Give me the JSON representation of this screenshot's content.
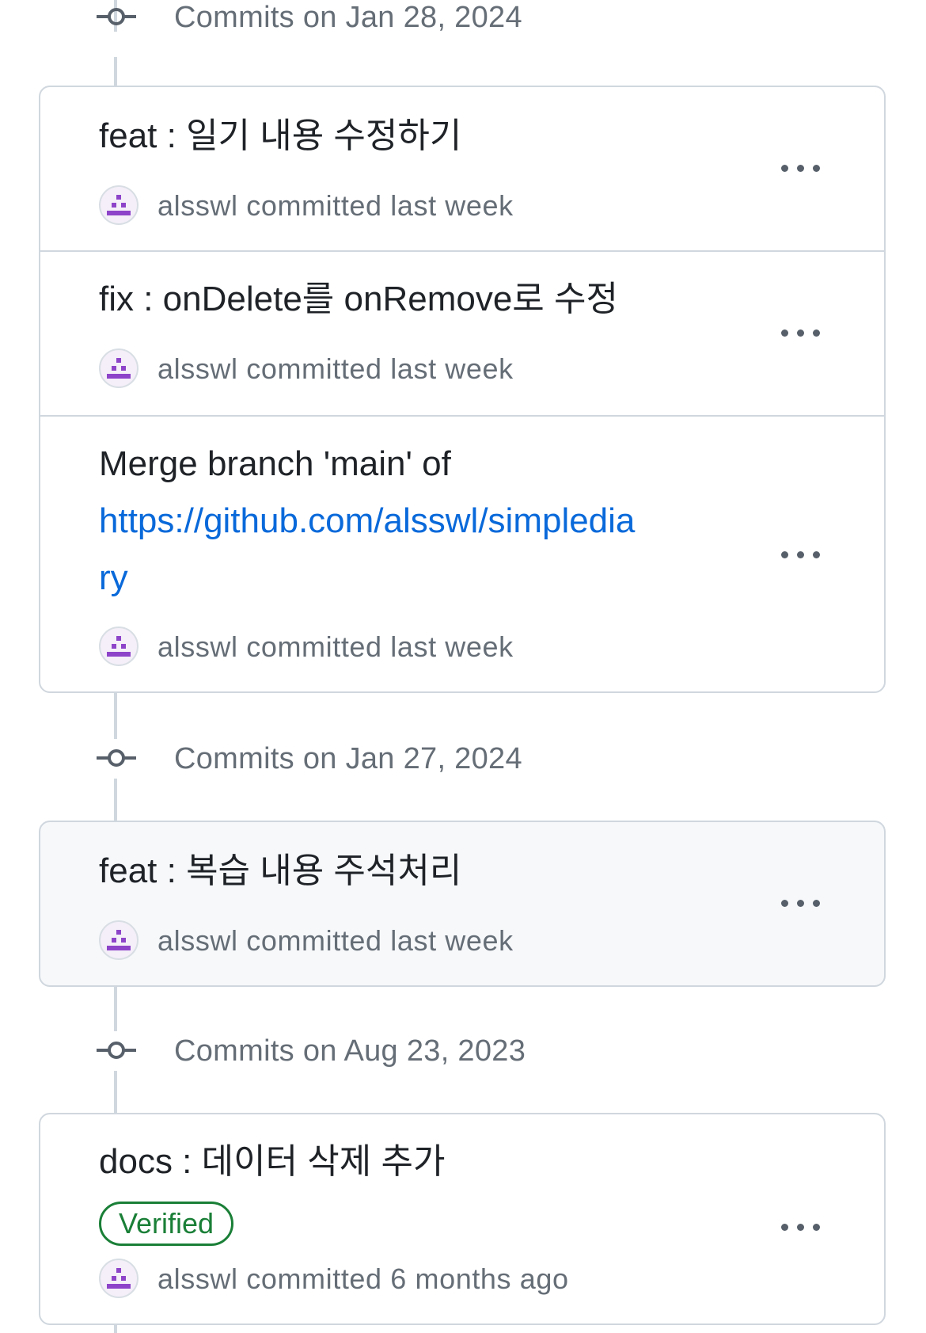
{
  "groups": [
    {
      "date_label": "Commits on Jan 28, 2024",
      "commits": [
        {
          "title": "feat : 일기 내용 수정하기",
          "meta": "alsswl committed last week"
        },
        {
          "title": "fix : onDelete를 onRemove로 수정",
          "meta": "alsswl committed last week"
        },
        {
          "title_line1": "Merge branch 'main' of",
          "title_link_line1": "https://github.com/alsswl/simpledia",
          "title_link_line2": "ry",
          "meta": "alsswl committed last week"
        }
      ]
    },
    {
      "date_label": "Commits on Jan 27, 2024",
      "commits": [
        {
          "title": "feat : 복습 내용 주석처리",
          "meta": "alsswl committed last week"
        }
      ]
    },
    {
      "date_label": "Commits on Aug 23, 2023",
      "commits": [
        {
          "title": "docs : 데이터 삭제 추가",
          "badge": "Verified",
          "meta": "alsswl committed 6 months ago"
        }
      ]
    }
  ],
  "icons": {
    "commit": "git-commit-icon",
    "more": "kebab-horizontal-icon",
    "avatar": "identicon-avatar"
  },
  "colors": {
    "link": "#0969da",
    "verified": "#1a7f37",
    "avatar_accent": "#8e44c9",
    "muted_text": "#656d76",
    "border": "#d0d7de"
  }
}
